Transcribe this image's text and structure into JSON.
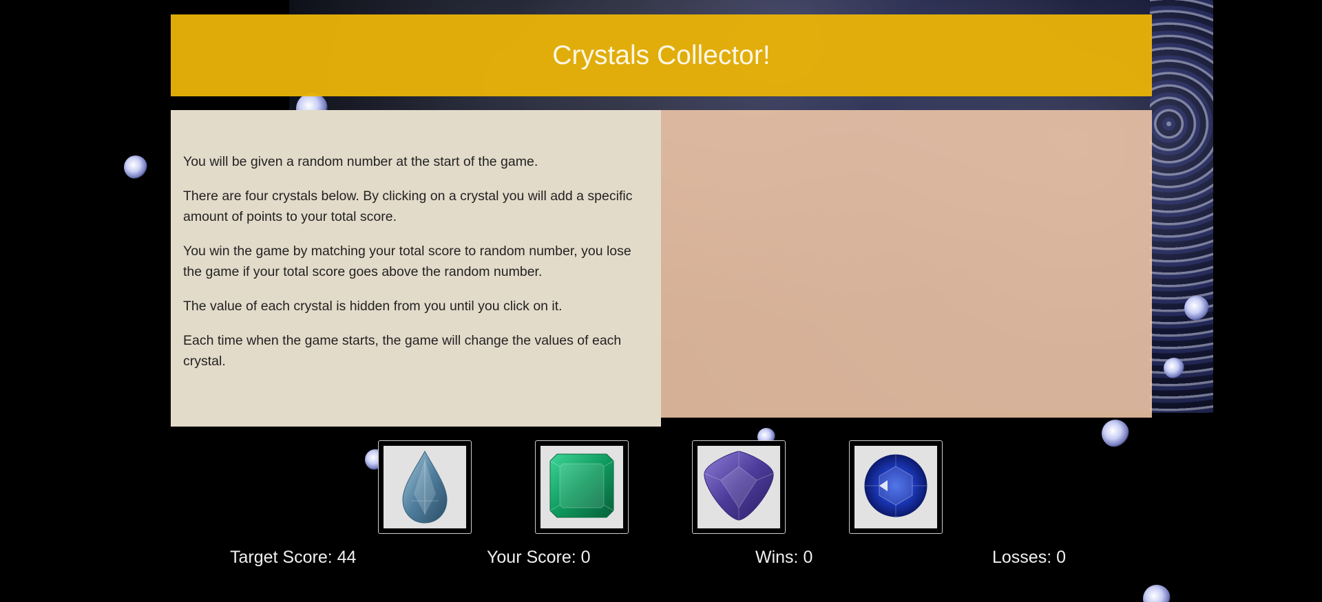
{
  "header": {
    "title": "Crystals Collector!"
  },
  "instructions": {
    "paragraphs": [
      "You will be given a random number at the start of the game.",
      "There are four crystals below. By clicking on a crystal you will add a specific amount of points to your total score.",
      "You win the game by matching your total score to random number, you lose the game if your total score goes above the random number.",
      "The value of each crystal is hidden from you until you click on it.",
      "Each time when the game starts, the game will change the values of each crystal."
    ]
  },
  "crystals": [
    {
      "name": "aquamarine",
      "icon": "teardrop-crystal-icon",
      "color": "#6f9bb8"
    },
    {
      "name": "emerald",
      "icon": "emerald-cut-crystal-icon",
      "color": "#12a56a"
    },
    {
      "name": "tanzanite",
      "icon": "trillion-crystal-icon",
      "color": "#5d4aa8"
    },
    {
      "name": "sapphire",
      "icon": "round-crystal-icon",
      "color": "#1c3bb0"
    }
  ],
  "stats": {
    "target_label": "Target Score: 44",
    "score_label": "Your Score: 0",
    "wins_label": "Wins: 0",
    "losses_label": "Losses: 0"
  },
  "colors": {
    "header": "#e8b208",
    "instructions_bg": "#e3dbca",
    "panel_bg": "#f2c8aa",
    "page_bg": "#000000"
  }
}
